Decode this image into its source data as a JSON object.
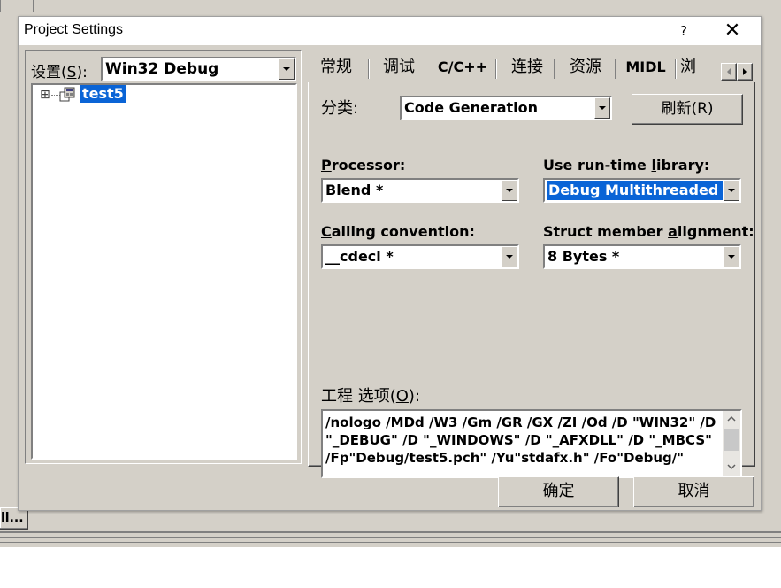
{
  "dialog": {
    "title": "Project Settings",
    "help_label": "?",
    "close_label": "✕"
  },
  "settings": {
    "label_prefix": "设置(",
    "label_key": "S",
    "label_suffix": "):",
    "value": "Win32 Debug"
  },
  "tree": {
    "expand_glyph": "⊞",
    "item_label": "test5"
  },
  "tabs": [
    "常规",
    "调试",
    "C/C++",
    "连接",
    "资源",
    "MIDL",
    "浏"
  ],
  "active_tab": "C/C++",
  "category": {
    "label": "分类:",
    "value": "Code Generation",
    "refresh_label": "刷新(R)"
  },
  "processor": {
    "label_key": "P",
    "label_rest": "rocessor:",
    "value": "Blend *"
  },
  "runtime": {
    "label_pre": "Use run-time ",
    "label_key": "l",
    "label_post": "ibrary:",
    "value": "Debug Multithreaded DLL"
  },
  "calling": {
    "label_key": "C",
    "label_rest": "alling convention:",
    "value": "__cdecl *"
  },
  "alignment": {
    "label_pre": "Struct member ",
    "label_key": "a",
    "label_post": "lignment:",
    "value": "8 Bytes *"
  },
  "options": {
    "label_prefix": "工程 选项(",
    "label_key": "O",
    "label_suffix": "):",
    "text": "/nologo /MDd /W3 /Gm /GR /GX /ZI /Od /D \"WIN32\" /D \"_DEBUG\" /D \"_WINDOWS\" /D \"_AFXDLL\" /D \"_MBCS\" /Fp\"Debug/test5.pch\" /Yu\"stdafx.h\" /Fo\"Debug/\""
  },
  "buttons": {
    "ok": "确定",
    "cancel": "取消"
  },
  "background": {
    "button_label": "il..."
  }
}
